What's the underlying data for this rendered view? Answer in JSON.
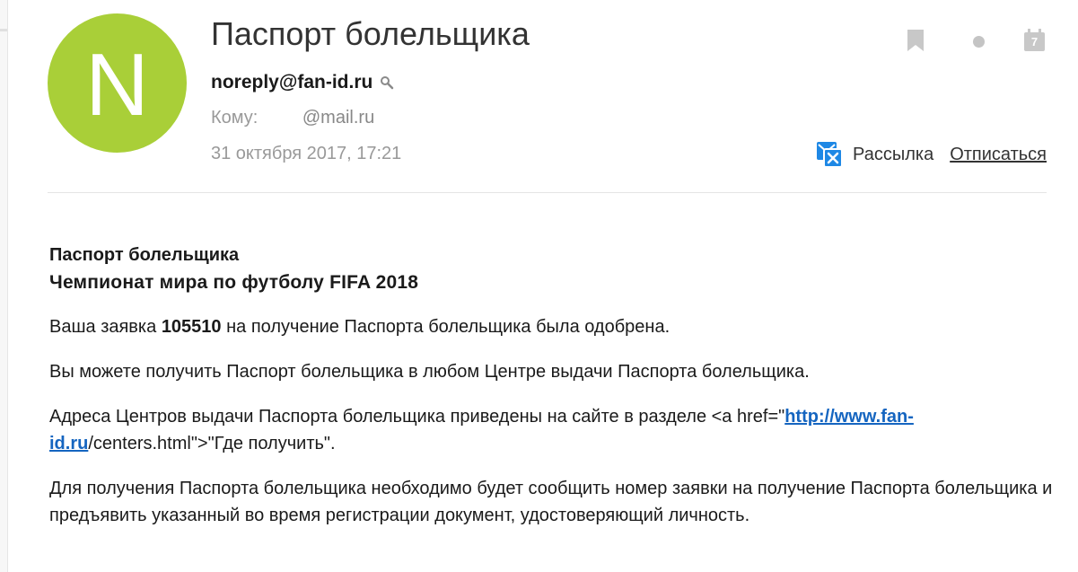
{
  "colors": {
    "avatar_bg": "#a9cf38",
    "link": "#1565c0",
    "newsletter_icon": "#1e88e5"
  },
  "icons": [
    "search-icon",
    "bookmark-icon",
    "dot-icon",
    "calendar-icon",
    "newsletter-icon"
  ],
  "header": {
    "avatar_letter": "N",
    "subject": "Паспорт болельщика",
    "sender": "noreply@fan-id.ru",
    "to_label": "Кому:",
    "to_value": "@mail.ru",
    "date": "31 октября 2017, 17:21",
    "calendar_day": "7",
    "mailing_label": "Рассылка",
    "unsubscribe_label": "Отписаться"
  },
  "body": {
    "title_1": "Паспорт болельщика",
    "title_2": "Чемпионат мира по футболу FIFA 2018",
    "p1_before": "Ваша заявка ",
    "p1_number": "105510",
    "p1_after": " на получение Паспорта болельщика была одобрена.",
    "p2": "Вы можете получить Паспорт болельщика в любом Центре выдачи Паспорта болельщика.",
    "p3_before": "Адреса Центров выдачи Паспорта болельщика приведены на сайте в разделе <a href=\"",
    "p3_link": "http://www.fan-id.ru",
    "p3_after": "/centers.html\">\"Где получить\".",
    "p4": "Для получения Паспорта болельщика необходимо будет сообщить номер заявки на получение Паспорта болельщика и предъявить указанный во время регистрации документ, удостоверяющий личность."
  }
}
